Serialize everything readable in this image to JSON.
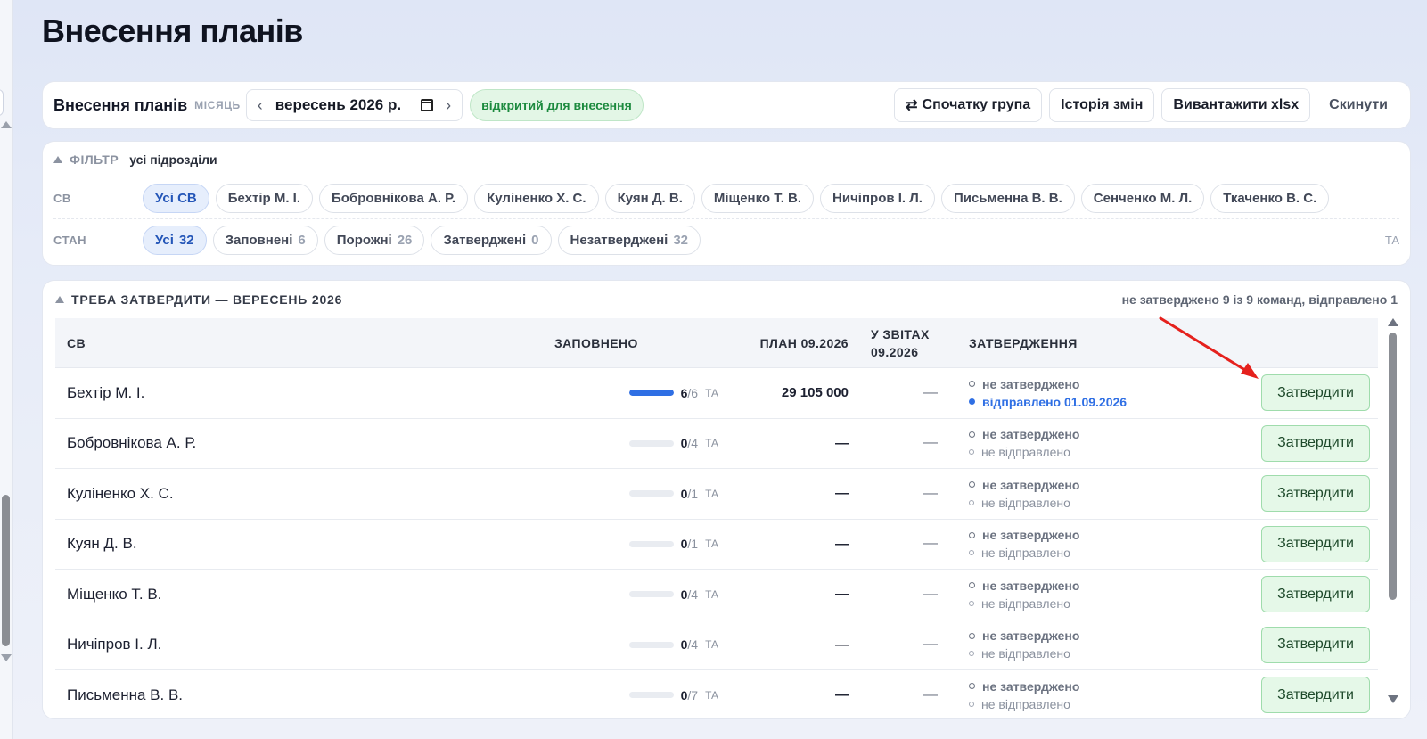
{
  "page_title": "Внесення планів",
  "toolbar": {
    "title": "Внесення планів",
    "month_label": "МІСЯЦЬ",
    "month_value": "вересень 2026 р.",
    "prev_arrow": "‹",
    "next_arrow": "›",
    "status": "відкритий для внесення",
    "swap_glyph": "⇄",
    "btn_group_first": "Спочатку група",
    "btn_history": "Історія змін",
    "btn_export": "Вивантажити xlsx",
    "btn_reset": "Скинути"
  },
  "filter": {
    "title": "ФІЛЬТР",
    "subtitle": "усі підрозділи",
    "sv_label": "СВ",
    "sv_chips": [
      "Усі СВ",
      "Бехтір М. І.",
      "Бобровнікова А. Р.",
      "Куліненко Х. С.",
      "Куян Д. В.",
      "Міщенко Т. В.",
      "Ничіпров І. Л.",
      "Письменна В. В.",
      "Сенченко М. Л.",
      "Ткаченко В. С."
    ],
    "state_label": "СТАН",
    "state_chips": [
      {
        "label": "Усі",
        "count": "32"
      },
      {
        "label": "Заповнені",
        "count": "6"
      },
      {
        "label": "Порожні",
        "count": "26"
      },
      {
        "label": "Затверджені",
        "count": "0"
      },
      {
        "label": "Незатверджені",
        "count": "32"
      }
    ],
    "ta_label": "ТА"
  },
  "approvals": {
    "title": "ТРЕБА ЗАТВЕРДИТИ — ВЕРЕСЕНЬ 2026",
    "summary": "не затверджено 9 із 9 команд, відправлено 1",
    "columns": {
      "sv": "СВ",
      "filled": "ЗАПОВНЕНО",
      "plan": "ПЛАН 09.2026",
      "reports": "У ЗВІТАХ 09.2026",
      "approval": "ЗАТВЕРДЖЕННЯ"
    },
    "approve_button": "Затвердити",
    "ta": "ТА",
    "rows": [
      {
        "name": "Бехтір М. І.",
        "filled": "6",
        "total": "/6",
        "fill_pct": 100,
        "plan": "29 105 000",
        "reports": "—",
        "status1": "не затверджено",
        "status2": "відправлено 01.09.2026",
        "sent": true
      },
      {
        "name": "Бобровнікова А. Р.",
        "filled": "0",
        "total": "/4",
        "fill_pct": 0,
        "plan": "—",
        "reports": "—",
        "status1": "не затверджено",
        "status2": "не відправлено",
        "sent": false
      },
      {
        "name": "Куліненко Х. С.",
        "filled": "0",
        "total": "/1",
        "fill_pct": 0,
        "plan": "—",
        "reports": "—",
        "status1": "не затверджено",
        "status2": "не відправлено",
        "sent": false
      },
      {
        "name": "Куян Д. В.",
        "filled": "0",
        "total": "/1",
        "fill_pct": 0,
        "plan": "—",
        "reports": "—",
        "status1": "не затверджено",
        "status2": "не відправлено",
        "sent": false
      },
      {
        "name": "Міщенко Т. В.",
        "filled": "0",
        "total": "/4",
        "fill_pct": 0,
        "plan": "—",
        "reports": "—",
        "status1": "не затверджено",
        "status2": "не відправлено",
        "sent": false
      },
      {
        "name": "Ничіпров І. Л.",
        "filled": "0",
        "total": "/4",
        "fill_pct": 0,
        "plan": "—",
        "reports": "—",
        "status1": "не затверджено",
        "status2": "не відправлено",
        "sent": false
      },
      {
        "name": "Письменна В. В.",
        "filled": "0",
        "total": "/7",
        "fill_pct": 0,
        "plan": "—",
        "reports": "—",
        "status1": "не затверджено",
        "status2": "не відправлено",
        "sent": false
      }
    ]
  },
  "colors": {
    "accent_blue": "#2f6fe4",
    "approve_green": "#e5f8e8",
    "status_green": "#1c8a3e",
    "annotation_red": "#e5211d"
  }
}
